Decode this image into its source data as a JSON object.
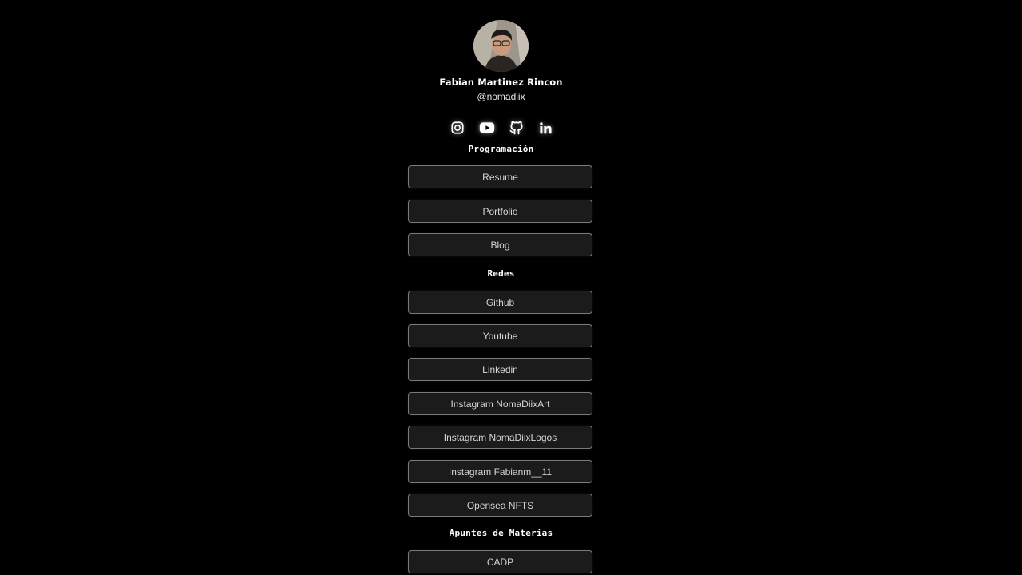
{
  "profile": {
    "name": "Fabian Martinez Rincon",
    "handle": "@nomadiix"
  },
  "social_icons": [
    "instagram-icon",
    "youtube-icon",
    "github-icon",
    "linkedin-icon"
  ],
  "sections": {
    "programacion": {
      "title": "Programación",
      "links": [
        "Resume",
        "Portfolio",
        "Blog"
      ]
    },
    "redes": {
      "title": "Redes",
      "links": [
        "Github",
        "Youtube",
        "Linkedin",
        "Instagram NomaDiixArt",
        "Instagram NomaDiixLogos",
        "Instagram Fabianm__11",
        "Opensea NFTS"
      ]
    },
    "apuntes": {
      "title": "Apuntes de Materias",
      "links": [
        "CADP"
      ]
    }
  },
  "colors": {
    "background": "#000000",
    "button_bg": "#1b1b1b",
    "button_border": "#7a7a7a",
    "text": "#ffffff"
  }
}
